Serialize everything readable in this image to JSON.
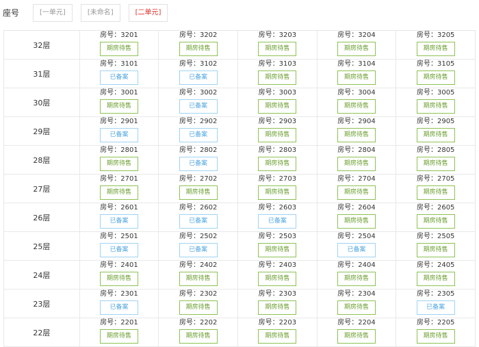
{
  "header": {
    "label": "座号",
    "tabs": [
      {
        "label": "[一单元]",
        "active": false
      },
      {
        "label": "[未命名]",
        "active": false
      },
      {
        "label": "[二单元]",
        "active": true
      }
    ]
  },
  "colors": {
    "green": "#8cc152",
    "blue": "#9fd3f3",
    "active_tab": "#e0302a"
  },
  "floors": [
    {
      "floor": "32层",
      "rooms": [
        {
          "no": "房号：3201",
          "status": "期房待售",
          "color": "green"
        },
        {
          "no": "房号：3202",
          "status": "期房待售",
          "color": "green"
        },
        {
          "no": "房号：3203",
          "status": "期房待售",
          "color": "green"
        },
        {
          "no": "房号：3204",
          "status": "期房待售",
          "color": "green"
        },
        {
          "no": "房号：3205",
          "status": "期房待售",
          "color": "green"
        }
      ]
    },
    {
      "floor": "31层",
      "rooms": [
        {
          "no": "房号：3101",
          "status": "已备案",
          "color": "blue"
        },
        {
          "no": "房号：3102",
          "status": "已备案",
          "color": "blue"
        },
        {
          "no": "房号：3103",
          "status": "期房待售",
          "color": "green"
        },
        {
          "no": "房号：3104",
          "status": "期房待售",
          "color": "green"
        },
        {
          "no": "房号：3105",
          "status": "期房待售",
          "color": "green"
        }
      ]
    },
    {
      "floor": "30层",
      "rooms": [
        {
          "no": "房号：3001",
          "status": "期房待售",
          "color": "green"
        },
        {
          "no": "房号：3002",
          "status": "已备案",
          "color": "blue"
        },
        {
          "no": "房号：3003",
          "status": "期房待售",
          "color": "green"
        },
        {
          "no": "房号：3004",
          "status": "期房待售",
          "color": "green"
        },
        {
          "no": "房号：3005",
          "status": "期房待售",
          "color": "green"
        }
      ]
    },
    {
      "floor": "29层",
      "rooms": [
        {
          "no": "房号：2901",
          "status": "已备案",
          "color": "blue"
        },
        {
          "no": "房号：2902",
          "status": "已备案",
          "color": "blue"
        },
        {
          "no": "房号：2903",
          "status": "期房待售",
          "color": "green"
        },
        {
          "no": "房号：2904",
          "status": "期房待售",
          "color": "green"
        },
        {
          "no": "房号：2905",
          "status": "期房待售",
          "color": "green"
        }
      ]
    },
    {
      "floor": "28层",
      "rooms": [
        {
          "no": "房号：2801",
          "status": "期房待售",
          "color": "green"
        },
        {
          "no": "房号：2802",
          "status": "已备案",
          "color": "blue"
        },
        {
          "no": "房号：2803",
          "status": "期房待售",
          "color": "green"
        },
        {
          "no": "房号：2804",
          "status": "期房待售",
          "color": "green"
        },
        {
          "no": "房号：2805",
          "status": "期房待售",
          "color": "green"
        }
      ]
    },
    {
      "floor": "27层",
      "rooms": [
        {
          "no": "房号：2701",
          "status": "期房待售",
          "color": "green"
        },
        {
          "no": "房号：2702",
          "status": "期房待售",
          "color": "green"
        },
        {
          "no": "房号：2703",
          "status": "期房待售",
          "color": "green"
        },
        {
          "no": "房号：2704",
          "status": "期房待售",
          "color": "green"
        },
        {
          "no": "房号：2705",
          "status": "期房待售",
          "color": "green"
        }
      ]
    },
    {
      "floor": "26层",
      "rooms": [
        {
          "no": "房号：2601",
          "status": "已备案",
          "color": "blue"
        },
        {
          "no": "房号：2602",
          "status": "已备案",
          "color": "blue"
        },
        {
          "no": "房号：2603",
          "status": "已备案",
          "color": "blue"
        },
        {
          "no": "房号：2604",
          "status": "期房待售",
          "color": "green"
        },
        {
          "no": "房号：2605",
          "status": "期房待售",
          "color": "green"
        }
      ]
    },
    {
      "floor": "25层",
      "rooms": [
        {
          "no": "房号：2501",
          "status": "已备案",
          "color": "blue"
        },
        {
          "no": "房号：2502",
          "status": "已备案",
          "color": "blue"
        },
        {
          "no": "房号：2503",
          "status": "期房待售",
          "color": "green"
        },
        {
          "no": "房号：2504",
          "status": "已备案",
          "color": "blue"
        },
        {
          "no": "房号：2505",
          "status": "期房待售",
          "color": "green"
        }
      ]
    },
    {
      "floor": "24层",
      "rooms": [
        {
          "no": "房号：2401",
          "status": "期房待售",
          "color": "green"
        },
        {
          "no": "房号：2402",
          "status": "期房待售",
          "color": "green"
        },
        {
          "no": "房号：2403",
          "status": "期房待售",
          "color": "green"
        },
        {
          "no": "房号：2404",
          "status": "期房待售",
          "color": "green"
        },
        {
          "no": "房号：2405",
          "status": "期房待售",
          "color": "green"
        }
      ]
    },
    {
      "floor": "23层",
      "rooms": [
        {
          "no": "房号：2301",
          "status": "已备案",
          "color": "blue"
        },
        {
          "no": "房号：2302",
          "status": "期房待售",
          "color": "green"
        },
        {
          "no": "房号：2303",
          "status": "期房待售",
          "color": "green"
        },
        {
          "no": "房号：2304",
          "status": "期房待售",
          "color": "green"
        },
        {
          "no": "房号：2305",
          "status": "已备案",
          "color": "blue"
        }
      ]
    },
    {
      "floor": "22层",
      "rooms": [
        {
          "no": "房号：2201",
          "status": "期房待售",
          "color": "green"
        },
        {
          "no": "房号：2202",
          "status": "期房待售",
          "color": "green"
        },
        {
          "no": "房号：2203",
          "status": "期房待售",
          "color": "green"
        },
        {
          "no": "房号：2204",
          "status": "期房待售",
          "color": "green"
        },
        {
          "no": "房号：2205",
          "status": "期房待售",
          "color": "green"
        }
      ]
    }
  ]
}
